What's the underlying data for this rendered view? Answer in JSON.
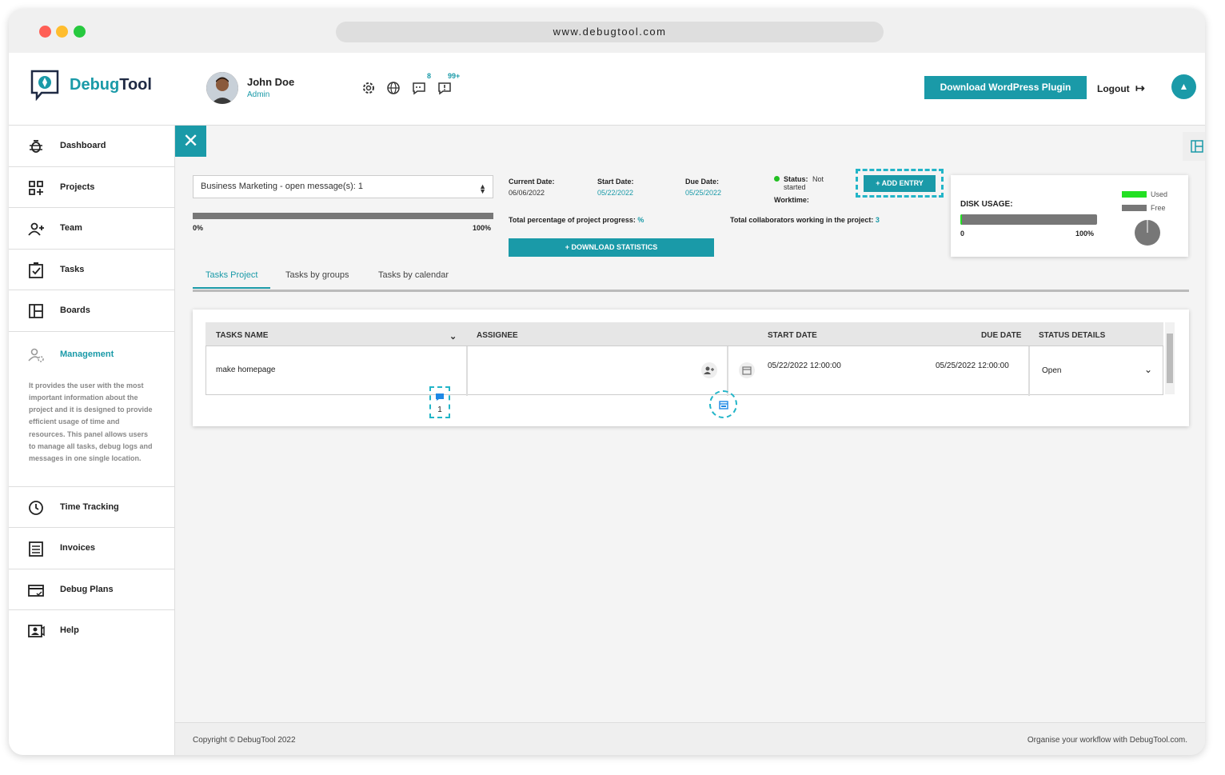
{
  "browser": {
    "url": "www.debugtool.com"
  },
  "brand": {
    "name_part1": "Debug",
    "name_part2": "Tool",
    "accent": "#1a9aa8"
  },
  "user": {
    "name": "John Doe",
    "role": "Admin"
  },
  "header": {
    "messages_badge": "8",
    "notifications_badge": "99+",
    "download_plugin_label": "Download WordPress Plugin",
    "logout_label": "Logout"
  },
  "sidebar": {
    "items": [
      {
        "label": "Dashboard",
        "icon": "bug-icon"
      },
      {
        "label": "Projects",
        "icon": "grid-icon"
      },
      {
        "label": "Team",
        "icon": "team-icon"
      },
      {
        "label": "Tasks",
        "icon": "checkbox-icon"
      },
      {
        "label": "Boards",
        "icon": "board-icon"
      },
      {
        "label": "Management",
        "icon": "user-gear-icon",
        "active": true
      },
      {
        "label": "Time Tracking",
        "icon": "clock-icon"
      },
      {
        "label": "Invoices",
        "icon": "invoice-icon"
      },
      {
        "label": "Debug Plans",
        "icon": "card-icon"
      },
      {
        "label": "Help",
        "icon": "help-icon"
      }
    ],
    "management_description": "It provides the user with the most important information about the project and it is designed to provide efficient usage of time and resources. This panel allows users to manage all tasks, debug logs and messages in one single location."
  },
  "project": {
    "selected": "Business Marketing - open message(s): 1",
    "progress_start": "0%",
    "progress_end": "100%",
    "current_date_label": "Current Date:",
    "current_date": "06/06/2022",
    "start_date_label": "Start Date:",
    "start_date": "05/22/2022",
    "due_date_label": "Due Date:",
    "due_date": "05/25/2022",
    "status_label": "Status:",
    "status_value": "Not started",
    "worktime_label": "Worktime:",
    "progress_text": "Total percentage of project progress:",
    "progress_value": "%",
    "collab_text": "Total collaborators working in the project:",
    "collab_value": "3",
    "add_entry_label": "+ ADD ENTRY",
    "download_stats_label": "+ DOWNLOAD STATISTICS"
  },
  "disk": {
    "title": "DISK USAGE:",
    "bar_start": "0",
    "bar_end": "100%",
    "legend_used": "Used",
    "legend_free": "Free",
    "used_color": "#22e022",
    "free_color": "#777777",
    "used_fraction": 0.01
  },
  "tabs": [
    "Tasks Project",
    "Tasks by groups",
    "Tasks by calendar"
  ],
  "table": {
    "headers": [
      "TASKS NAME",
      "ASSIGNEE",
      "START DATE",
      "DUE DATE",
      "STATUS DETAILS"
    ],
    "rows": [
      {
        "name": "make homepage",
        "comments": "1",
        "start": "05/22/2022 12:00:00",
        "due": "05/25/2022 12:00:00",
        "status": "Open"
      }
    ]
  },
  "footer": {
    "copyright": "Copyright © DebugTool 2022",
    "tagline": "Organise your workflow with DebugTool.com."
  }
}
